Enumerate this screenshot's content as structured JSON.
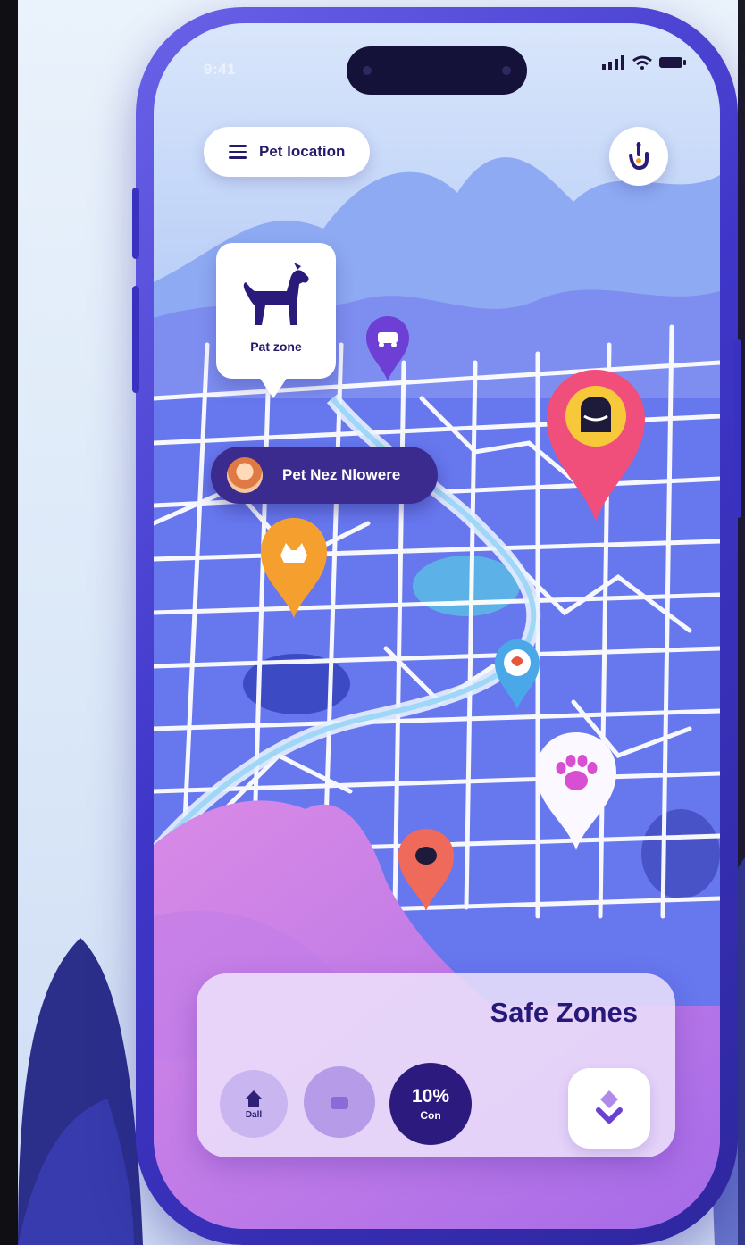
{
  "status_bar": {
    "time": "9:41"
  },
  "header": {
    "title": "Pet location"
  },
  "zone_card": {
    "label": "Pat zone"
  },
  "pet_pill": {
    "label": "Pet Nez Nlowere"
  },
  "bottom_panel": {
    "title": "Safe Zones",
    "home_label": "Dall",
    "percent": "10%",
    "percent_sub": "Con"
  },
  "colors": {
    "accent": "#3b2b8e",
    "map_base": "#6d7df2",
    "pin_red": "#ef4f7a",
    "pin_orange": "#f5a02e",
    "pin_blue": "#4aa8e8"
  },
  "icons": [
    "menu-icon",
    "location-hand-icon",
    "dog-icon",
    "paw-icon",
    "home-icon",
    "chevron-icon",
    "signal-icon",
    "wifi-icon",
    "battery-icon"
  ]
}
